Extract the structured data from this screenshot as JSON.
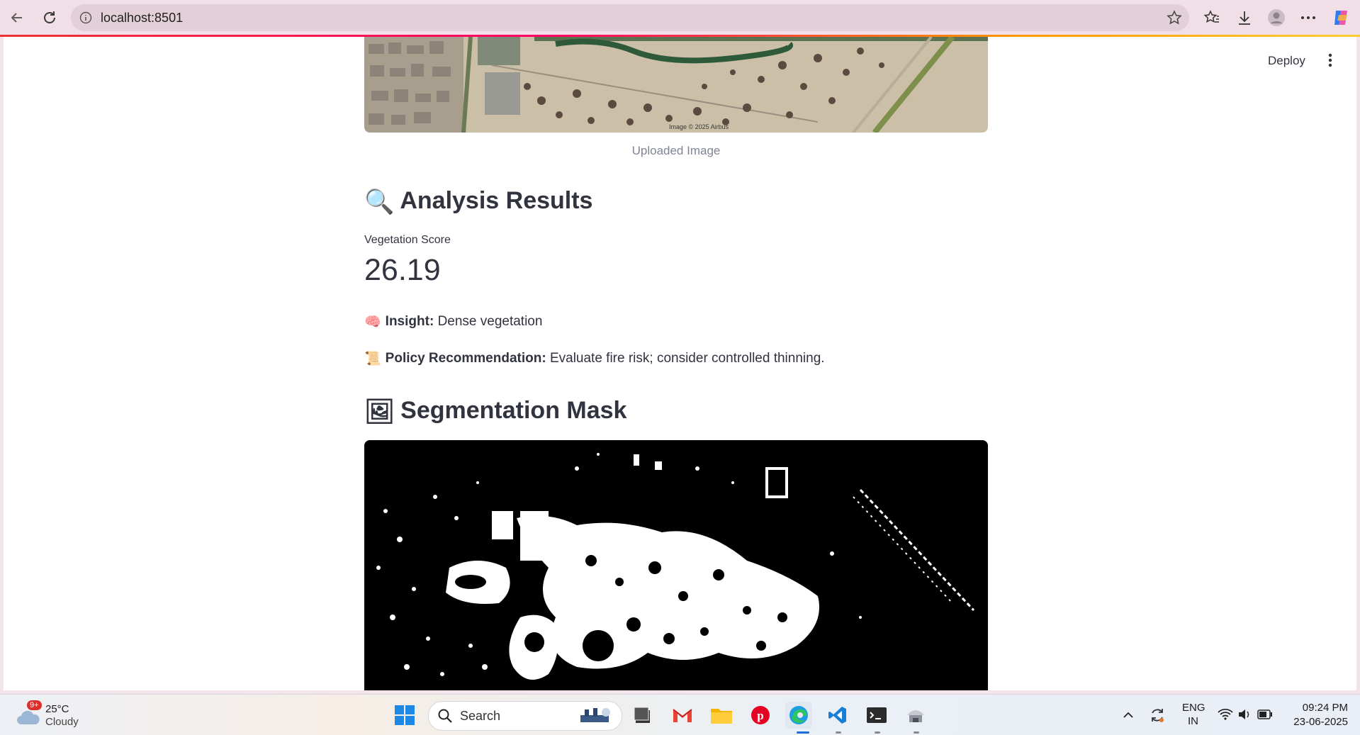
{
  "browser": {
    "url": "localhost:8501"
  },
  "app": {
    "deploy_label": "Deploy",
    "image_caption": "Uploaded Image",
    "analysis_heading": "Analysis Results",
    "analysis_emoji": "🔍",
    "metric": {
      "label": "Vegetation Score",
      "value": "26.19"
    },
    "insight": {
      "emoji": "🧠",
      "label": "Insight:",
      "text": "Dense vegetation"
    },
    "policy": {
      "emoji": "📜",
      "label": "Policy Recommendation:",
      "text": "Evaluate fire risk; consider controlled thinning."
    },
    "segmentation_heading": "Segmentation Mask",
    "segmentation_emoji": "🖼",
    "image_watermark": "Image © 2025 Airbus"
  },
  "taskbar": {
    "weather": {
      "badge": "9+",
      "temp": "25°C",
      "desc": "Cloudy"
    },
    "search_label": "Search",
    "lang": "ENG",
    "region": "IN",
    "time": "09:24 PM",
    "date": "23-06-2025"
  }
}
